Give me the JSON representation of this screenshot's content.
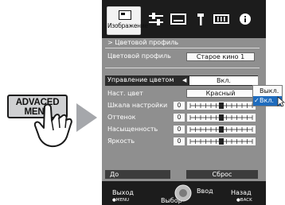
{
  "remote_key": {
    "line1": "ADVACED",
    "line2": "MENU"
  },
  "tabs": [
    {
      "label": "Изображение",
      "icon": "picture-icon",
      "selected": true
    },
    {
      "icon": "adjust-sliders-icon"
    },
    {
      "icon": "screen-icon"
    },
    {
      "icon": "wrench-icon"
    },
    {
      "icon": "network-icon"
    },
    {
      "icon": "info-icon"
    }
  ],
  "breadcrumb": "> Цветовой профиль",
  "color_profile": {
    "label": "Цветовой профиль",
    "value": "Старое кино 1"
  },
  "color_management": {
    "label": "Управление цветом",
    "value": "Вкл."
  },
  "dropdown": {
    "options": [
      "Выкл.",
      "Вкл."
    ],
    "selected": "Вкл."
  },
  "set_color": {
    "label": "Наст. цвет",
    "value": "Красный"
  },
  "sliders": [
    {
      "label": "Шкала настройки",
      "value": "0"
    },
    {
      "label": "Оттенок",
      "value": "0"
    },
    {
      "label": "Насыщенность",
      "value": "0"
    },
    {
      "label": "Яркость",
      "value": "0"
    }
  ],
  "buttons": {
    "before": "До",
    "reset": "Сброс"
  },
  "footer": {
    "exit": "Выход",
    "exit_sub": "●MENU",
    "select": "Выбор",
    "enter": "Ввод",
    "back": "Назад",
    "back_sub": "●BACK"
  },
  "colors": {
    "highlight": "#2b2b2b",
    "selected_option": "#1e6bbd",
    "panel": "#8f8f8f",
    "bar": "#1c1c1c"
  }
}
